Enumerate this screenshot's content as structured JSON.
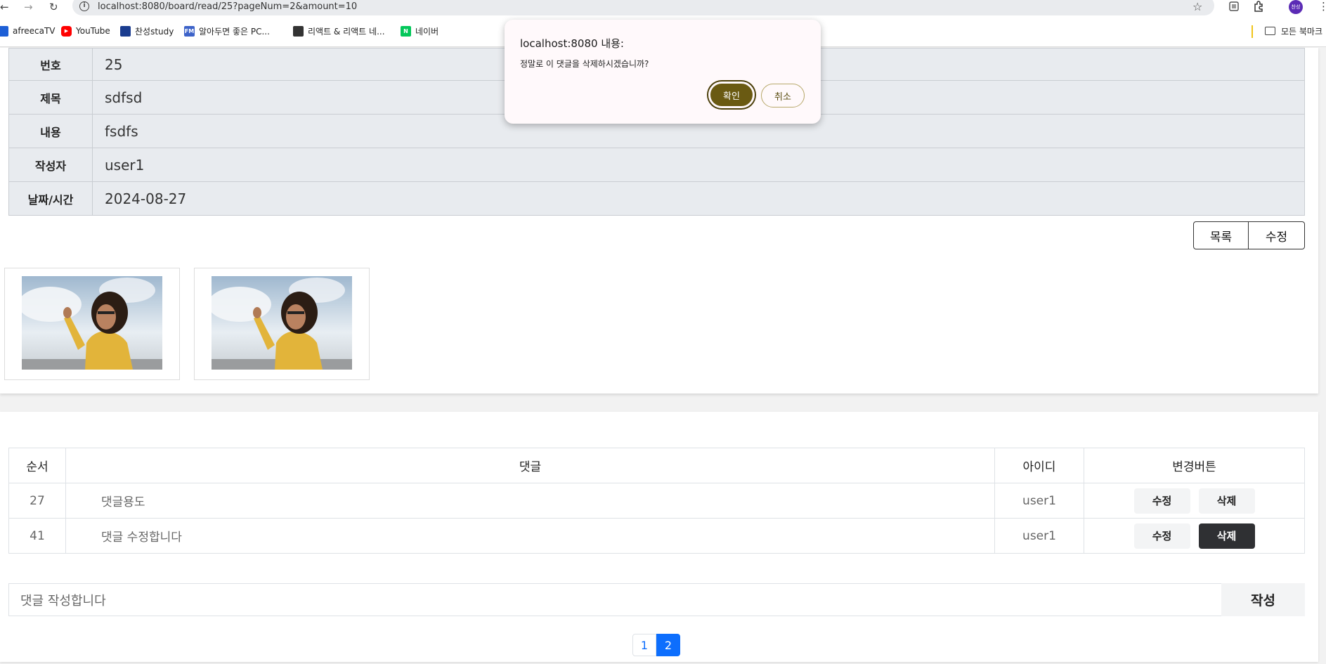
{
  "browser": {
    "url": "localhost:8080/board/read/25?pageNum=2&amount=10",
    "profile_initials": "찬성",
    "bookmarks": [
      {
        "label": "afreecaTV",
        "icon": "afreecatv-icon",
        "color": "#1d5fd6"
      },
      {
        "label": "YouTube",
        "icon": "youtube-icon",
        "color": "#ff0000"
      },
      {
        "label": "찬성study",
        "icon": "study-icon",
        "color": "#1a3c8f"
      },
      {
        "label": "알아두면 좋은 PC...",
        "icon": "fm-icon",
        "color": "#3d63c9"
      },
      {
        "label": "리액트 & 리액트 네...",
        "icon": "contact-card-icon",
        "color": "#333333"
      },
      {
        "label": "네이버",
        "icon": "naver-icon",
        "color": "#03c75a"
      }
    ],
    "all_bookmarks_label": "모든 북마크"
  },
  "board": {
    "rows": [
      {
        "label": "번호",
        "value": "25"
      },
      {
        "label": "제목",
        "value": "sdfsd"
      },
      {
        "label": "내용",
        "value": "fsdfs"
      },
      {
        "label": "작성자",
        "value": "user1"
      },
      {
        "label": "날짜/시간",
        "value": "2024-08-27"
      }
    ],
    "list_button": "목록",
    "edit_button": "수정"
  },
  "replies": {
    "headers": [
      "순서",
      "댓글",
      "아이디",
      "변경버튼"
    ],
    "items": [
      {
        "no": "27",
        "text": "댓글용도",
        "user": "user1",
        "edit": "수정",
        "delete": "삭제"
      },
      {
        "no": "41",
        "text": "댓글 수정합니다",
        "user": "user1",
        "edit": "수정",
        "delete": "삭제"
      }
    ],
    "input_value": "댓글 작성합니다",
    "submit_label": "작성"
  },
  "pagination": {
    "pages": [
      "1",
      "2"
    ],
    "current": "2"
  },
  "dialog": {
    "title": "localhost:8080 내용:",
    "message": "정말로 이 댓글을 삭제하시겠습니까?",
    "ok_label": "확인",
    "cancel_label": "취소"
  },
  "colors": {
    "dialog_ok": "#6a5a12",
    "page_active": "#0d6efd",
    "delete_active": "#2f3033"
  }
}
